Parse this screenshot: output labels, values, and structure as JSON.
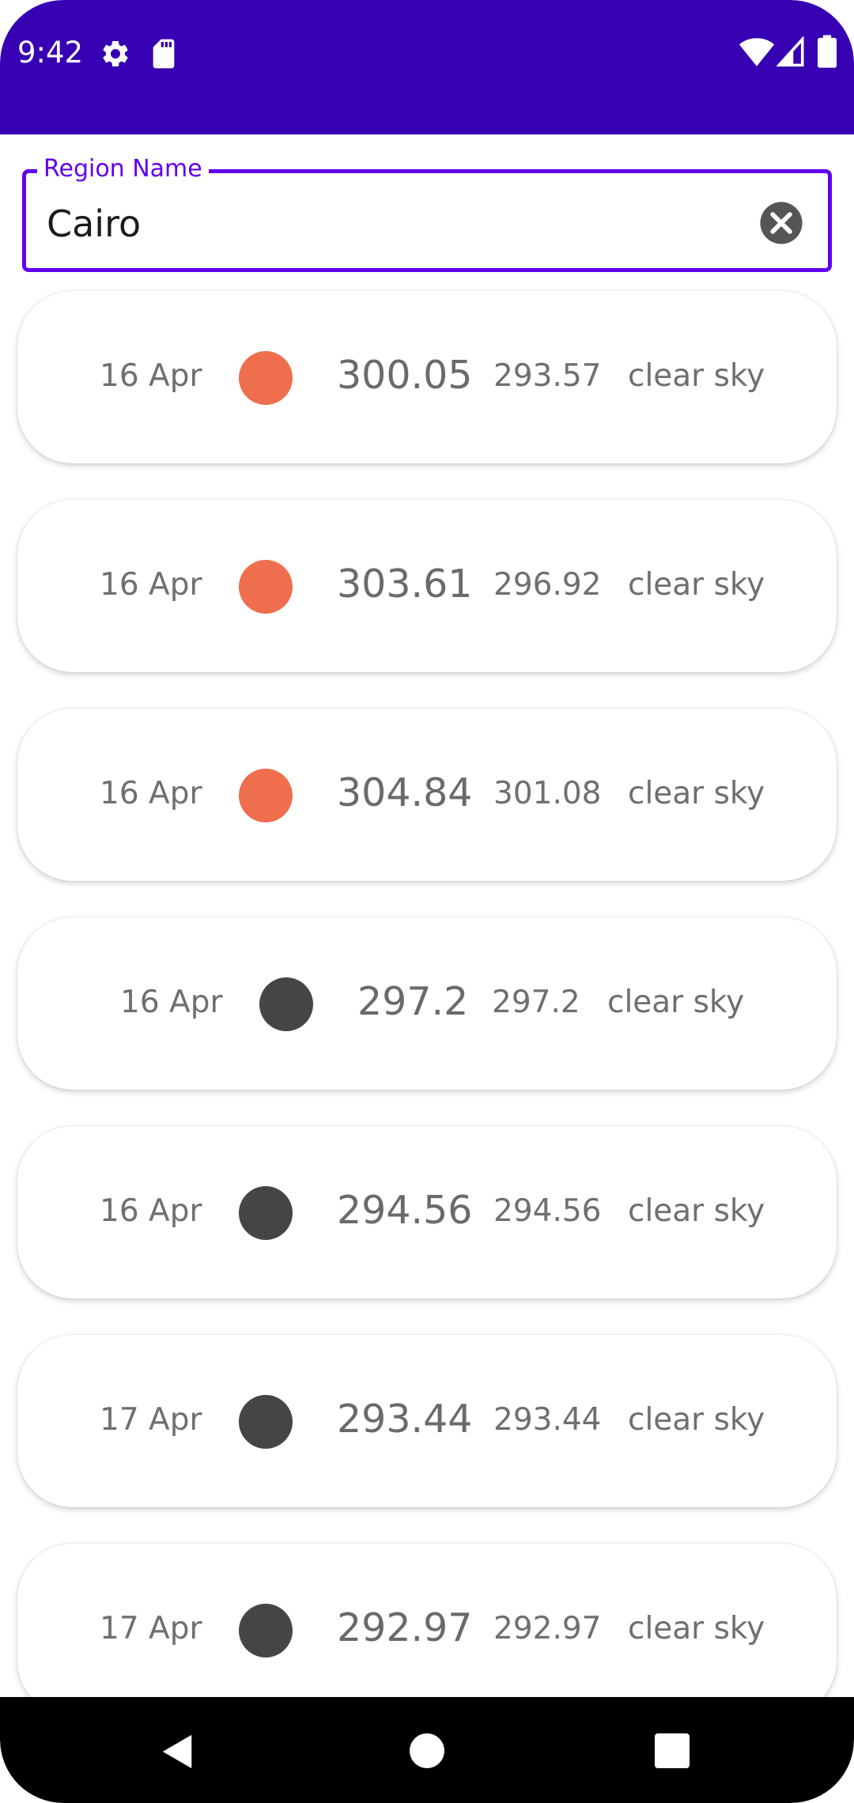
{
  "status_bar": {
    "time": "9:42",
    "background_color": "#3700b3",
    "icons": [
      "gear-icon",
      "sd-card-icon",
      "wifi-icon",
      "cell-signal-icon",
      "battery-icon"
    ]
  },
  "search": {
    "label": "Region Name",
    "value": "Cairo",
    "accent_color": "#6200ee",
    "clear_icon": "clear-icon"
  },
  "forecast": [
    {
      "date": "16 Apr",
      "temp": "300.05",
      "feels_like": "293.57",
      "description": "clear sky",
      "indicator_color": "#ee6e4d"
    },
    {
      "date": "16 Apr",
      "temp": "303.61",
      "feels_like": "296.92",
      "description": "clear sky",
      "indicator_color": "#ee6e4d"
    },
    {
      "date": "16 Apr",
      "temp": "304.84",
      "feels_like": "301.08",
      "description": "clear sky",
      "indicator_color": "#ee6e4d"
    },
    {
      "date": "16 Apr",
      "temp": "297.2",
      "feels_like": "297.2",
      "description": "clear sky",
      "indicator_color": "#454547"
    },
    {
      "date": "16 Apr",
      "temp": "294.56",
      "feels_like": "294.56",
      "description": "clear sky",
      "indicator_color": "#454547"
    },
    {
      "date": "17 Apr",
      "temp": "293.44",
      "feels_like": "293.44",
      "description": "clear sky",
      "indicator_color": "#454547"
    },
    {
      "date": "17 Apr",
      "temp": "292.97",
      "feels_like": "292.97",
      "description": "clear sky",
      "indicator_color": "#454547"
    }
  ],
  "nav_bar": {
    "icons": [
      "back-icon",
      "home-icon",
      "recents-icon"
    ]
  }
}
